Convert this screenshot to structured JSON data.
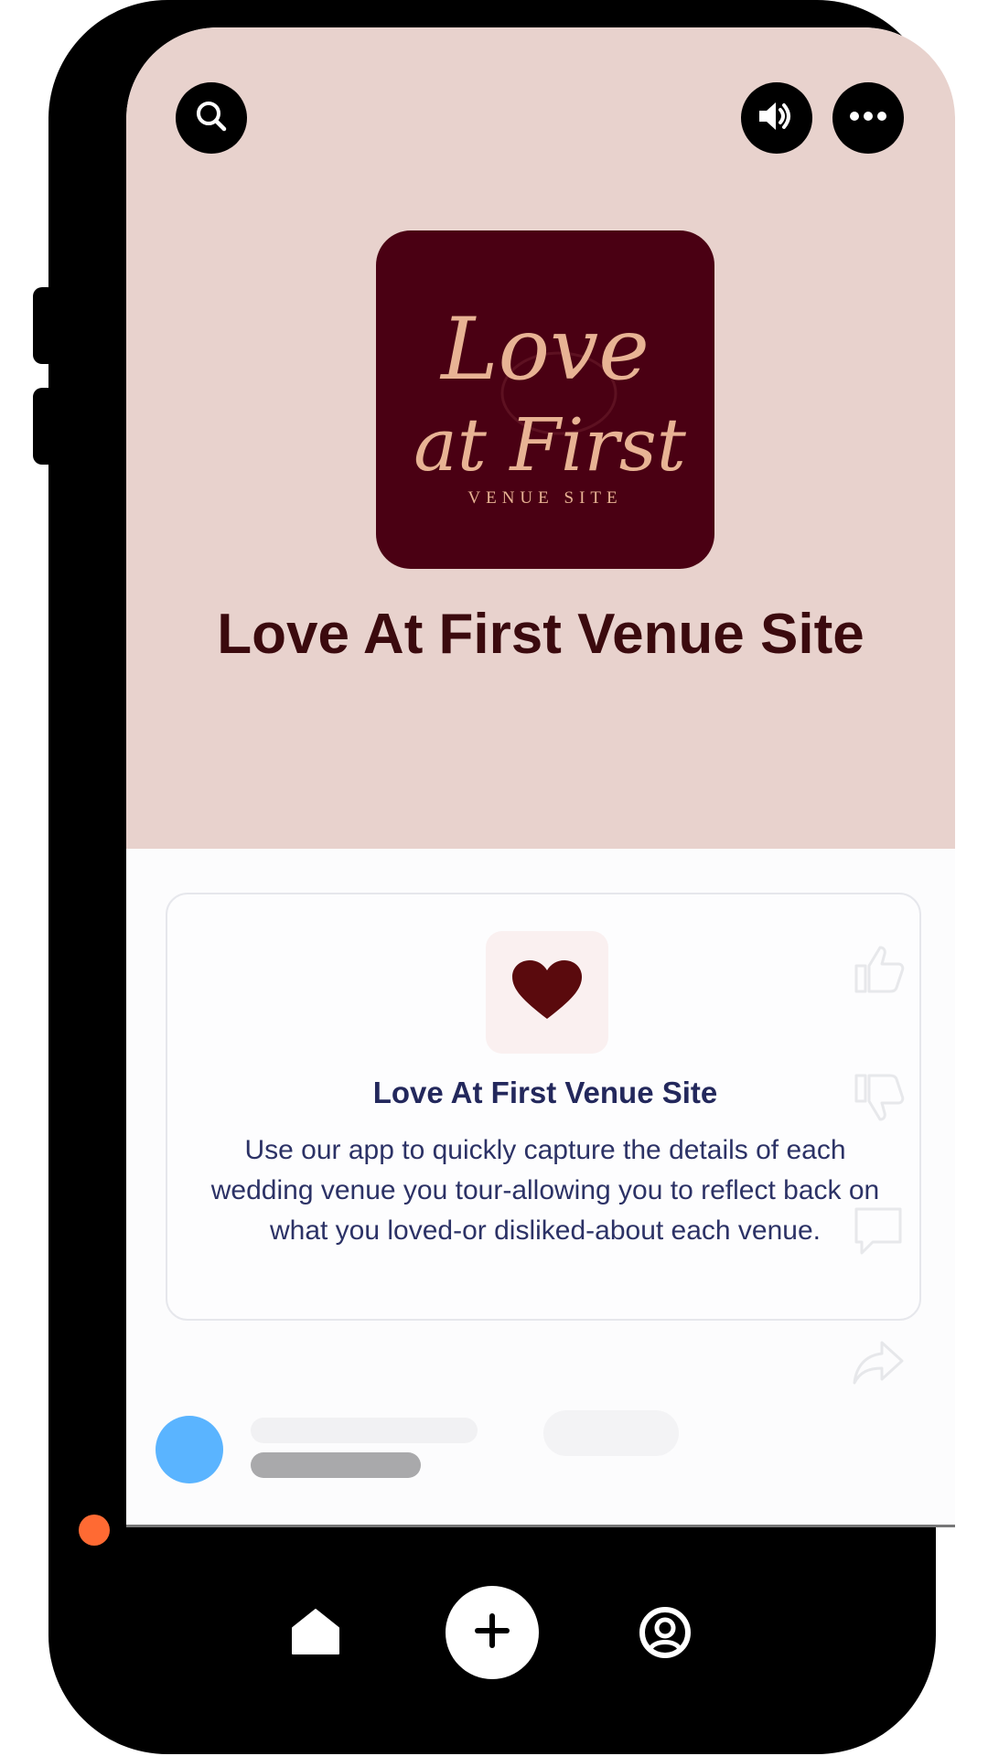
{
  "header": {
    "search_icon": "search-icon",
    "sound_icon": "speaker-icon",
    "more_icon": "more-icon"
  },
  "logo": {
    "script_line1": "Love",
    "script_line2": "at First",
    "tagline": "VENUE SITE"
  },
  "app": {
    "title": "Love At First Venue Site"
  },
  "card": {
    "icon": "heart-icon",
    "title": "Love At First Venue Site",
    "description": "Use our app to quickly capture the details of each wedding venue you tour-allowing you to reflect back on what you loved-or disliked-about each venue."
  },
  "side_actions": [
    "thumbs-up-icon",
    "thumbs-down-icon",
    "comment-icon",
    "share-icon"
  ],
  "bottom_nav": [
    "home-icon",
    "plus-icon",
    "profile-icon"
  ],
  "colors": {
    "hero_bg": "#e8d2cd",
    "logo_bg": "#4a0013",
    "title_color": "#3b0a0e",
    "logo_gold": "#e8b394",
    "heart": "#5a0a0d",
    "avatar": "#5ab4ff",
    "progress_dot": "#ff6a33"
  }
}
